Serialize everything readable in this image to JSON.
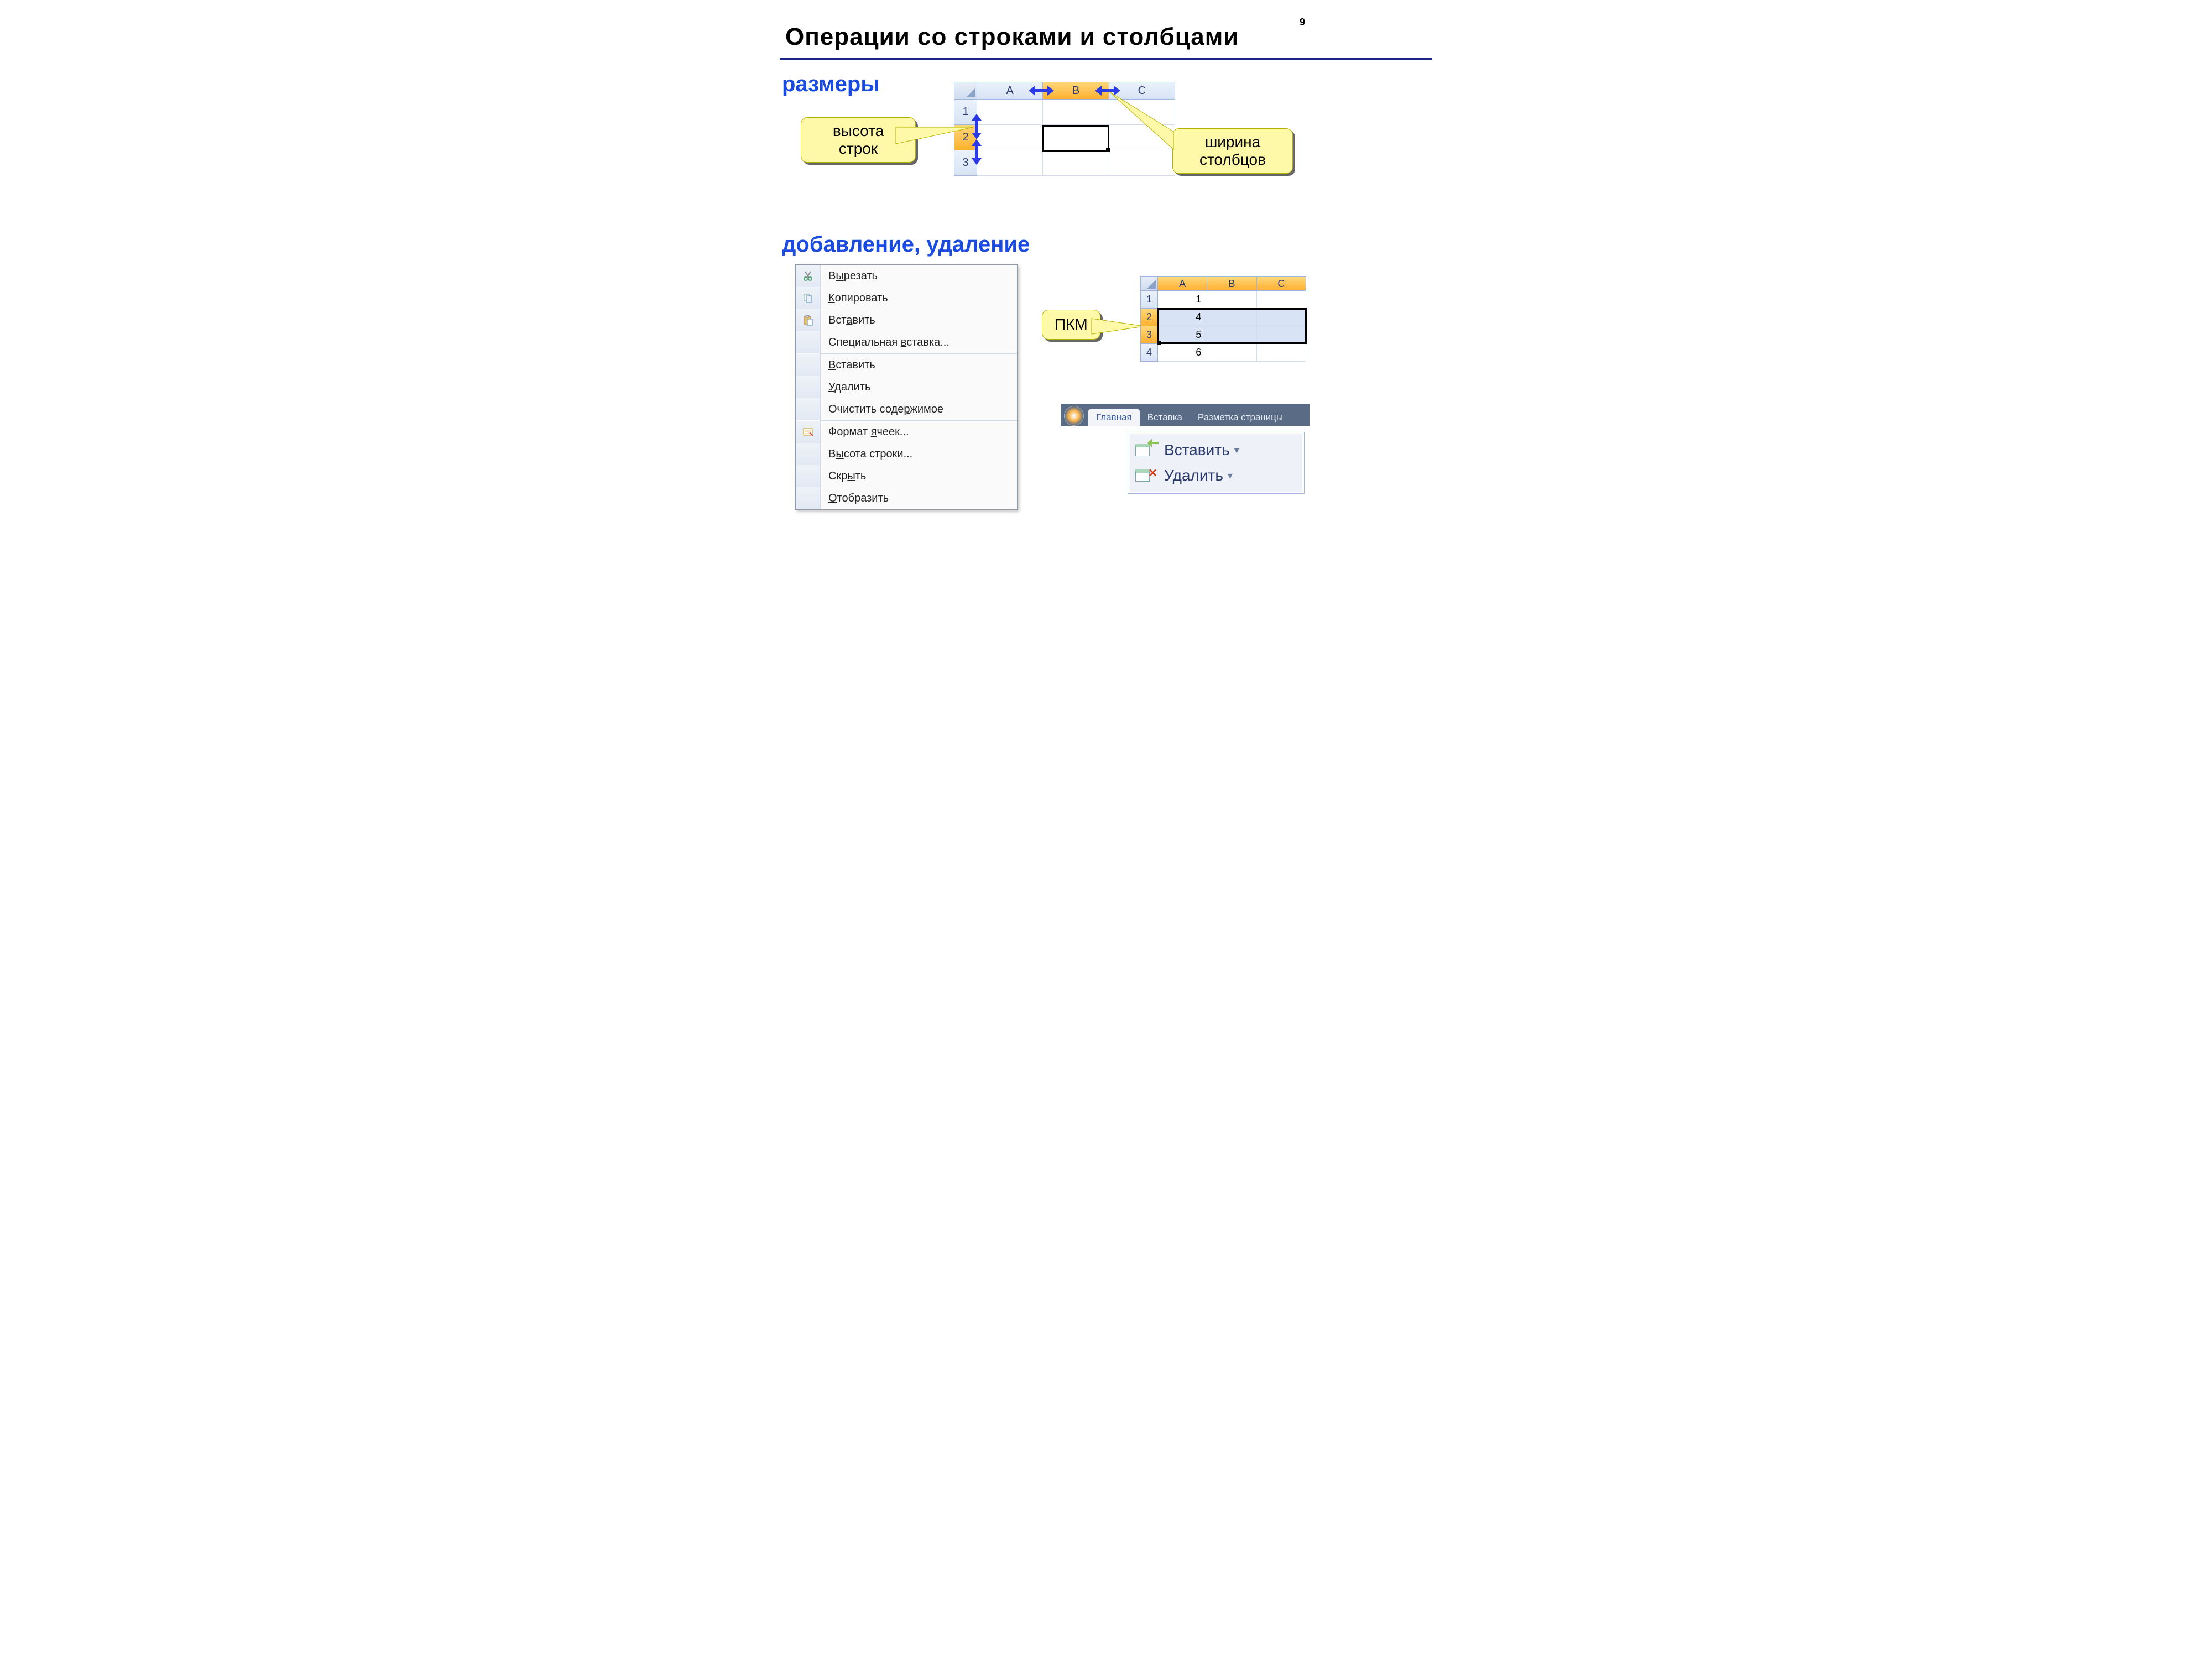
{
  "pageNumber": "9",
  "title": "Операции со строками и столбцами",
  "section1": "размеры",
  "section2": "добавление, удаление",
  "callouts": {
    "rowHeight": "высота\nстрок",
    "colWidth": "ширина\nстолбцов",
    "rmb": "ПКМ"
  },
  "sheet1": {
    "cols": [
      "A",
      "B",
      "C"
    ],
    "rows": [
      "1",
      "2",
      "3"
    ]
  },
  "sheet2": {
    "cols": [
      "A",
      "B",
      "C"
    ],
    "rows": [
      {
        "n": "1",
        "a": "1"
      },
      {
        "n": "2",
        "a": "4"
      },
      {
        "n": "3",
        "a": "5"
      },
      {
        "n": "4",
        "a": "6"
      }
    ]
  },
  "contextMenu": [
    {
      "icon": "cut",
      "label": "Вырезать",
      "u": 1
    },
    {
      "icon": "copy",
      "label": "Копировать",
      "u": 0
    },
    {
      "icon": "paste",
      "label": "Вставить",
      "u": 3
    },
    {
      "icon": "",
      "label": "Специальная вставка...",
      "u": 12,
      "sepAfter": true
    },
    {
      "icon": "",
      "label": "Вставить",
      "u": 0
    },
    {
      "icon": "",
      "label": "Удалить",
      "u": 0
    },
    {
      "icon": "",
      "label": "Очистить содержимое",
      "u": 13,
      "sepAfter": true
    },
    {
      "icon": "format",
      "label": "Формат ячеек...",
      "u": 7
    },
    {
      "icon": "",
      "label": "Высота строки...",
      "u": 1
    },
    {
      "icon": "",
      "label": "Скрыть",
      "u": 3
    },
    {
      "icon": "",
      "label": "Отобразить",
      "u": 0
    }
  ],
  "ribbon": {
    "tabs": [
      "Главная",
      "Вставка",
      "Разметка страницы"
    ],
    "active": 0
  },
  "buttons": {
    "insert": "Вставить",
    "delete": "Удалить"
  }
}
